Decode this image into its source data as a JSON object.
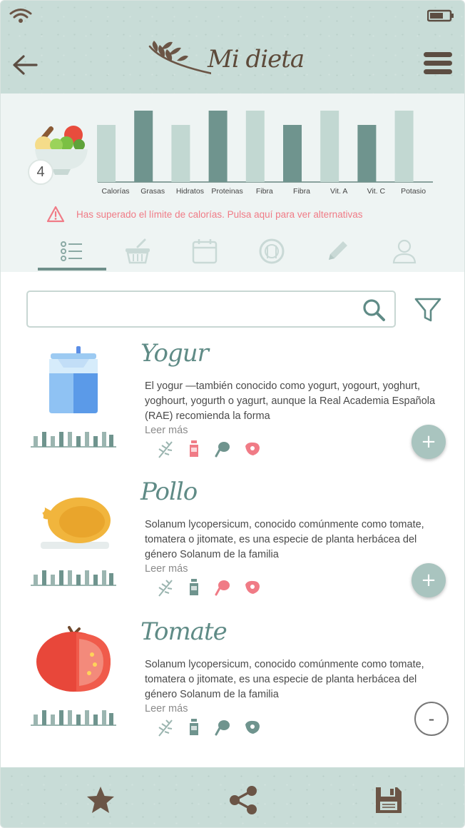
{
  "header": {
    "title": "Mi dieta",
    "icons": {
      "wifi": "wifi-icon",
      "battery": "battery-icon",
      "back": "arrow-left-icon",
      "menu": "hamburger-menu-icon"
    }
  },
  "summary": {
    "count": "4",
    "warning": "Has superado el límite de calorías. Pulsa aquí para ver alternativas",
    "colors": {
      "light": "#c2d8d2",
      "dark": "#6f948e",
      "warning": "#f07b86"
    }
  },
  "chart_data": {
    "type": "bar",
    "categories": [
      "Calorías",
      "Grasas",
      "Hidratos",
      "Proteinas",
      "Fibra",
      "Fibra",
      "Vit. A",
      "Vit. C",
      "Potasio"
    ],
    "values": [
      80,
      100,
      80,
      100,
      100,
      80,
      100,
      80,
      100
    ],
    "ylim": [
      0,
      100
    ],
    "bar_colors": [
      "#c2d8d2",
      "#6f948e",
      "#c2d8d2",
      "#6f948e",
      "#c2d8d2",
      "#6f948e",
      "#c2d8d2",
      "#6f948e",
      "#c2d8d2"
    ],
    "grid": false
  },
  "tabs": [
    {
      "icon": "list-icon",
      "active": true
    },
    {
      "icon": "basket-icon",
      "active": false
    },
    {
      "icon": "calendar-icon",
      "active": false
    },
    {
      "icon": "plate-icon",
      "active": false
    },
    {
      "icon": "pencil-icon",
      "active": false
    },
    {
      "icon": "user-icon",
      "active": false
    }
  ],
  "search": {
    "value": "",
    "placeholder": ""
  },
  "items": [
    {
      "title": "Yogur",
      "desc": "El yogur —también conocido como yogurt, yogourt, yoghurt, yoghourt, yogurth o yagurt, aunque la Real Academia Española (RAE) recomienda la forma",
      "more": "Leer más",
      "action": "+",
      "image": "yogurt-bottle-icon"
    },
    {
      "title": "Pollo",
      "desc": "Solanum lycopersicum, conocido comúnmente como tomate, tomatera o jitomate, es una especie de planta herbácea del género Solanum de la familia",
      "more": "Leer más",
      "action": "+",
      "image": "roast-chicken-icon"
    },
    {
      "title": "Tomate",
      "desc": "Solanum lycopersicum, conocido comúnmente como tomate, tomatera o jitomate, es una especie de planta herbácea del género Solanum de la familia",
      "more": "Leer más",
      "action": "-",
      "image": "tomato-icon"
    }
  ],
  "footer": {
    "icons": [
      "star-icon",
      "share-icon",
      "save-icon"
    ],
    "color": "#6b5546"
  }
}
